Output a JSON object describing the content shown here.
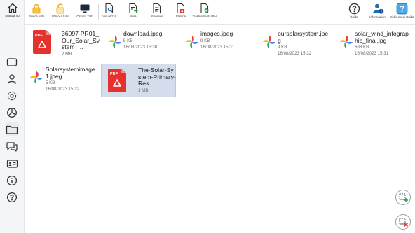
{
  "rail": {
    "home_label": "Stanza 4b",
    "items": [
      "square-icon",
      "person-outline-icon",
      "gear-icon",
      "pie-chart-icon",
      "folder-icon",
      "chat-bubbles-icon",
      "id-card-icon",
      "info-icon",
      "help-icon"
    ]
  },
  "toolbar": {
    "lock_all": "Blocca tutto",
    "unlock_all": "Sblocca tutto",
    "darken_all": "Oscura Tutti",
    "view": "Visualizza",
    "send": "Invia",
    "rename": "Rinomina",
    "delete": "Elimina",
    "transfers": "Trasferimenti attivi",
    "guide": "Guida",
    "info": "Informazioni",
    "guide_requests": "Richieste di Guida"
  },
  "files": [
    {
      "name": "36097-PR01_Our_Solar_System_...",
      "meta1": "2 MB",
      "meta2": "",
      "type": "pdf"
    },
    {
      "name": "download.jpeg",
      "meta1": "5 KB",
      "meta2": "16/08/2023 15:30",
      "type": "image"
    },
    {
      "name": "images.jpeg",
      "meta1": "9 KB",
      "meta2": "16/08/2023 15:31",
      "type": "image"
    },
    {
      "name": "oursolarsystem.jpeg",
      "meta1": "9 KB",
      "meta2": "16/08/2023 15:32",
      "type": "image"
    },
    {
      "name": "solar_wind_infographic_final.jpg",
      "meta1": "688 KB",
      "meta2": "16/08/2023 15:31",
      "type": "image"
    },
    {
      "name": "Solarsystemimage1.jpeg",
      "meta1": "5 KB",
      "meta2": "16/08/2023 15:32",
      "type": "image"
    },
    {
      "name": "The-Solar-System-Primary-Res...",
      "meta1": "1 MB",
      "meta2": "",
      "type": "pdf",
      "selected": true
    }
  ],
  "colors": {
    "accent": "#1f6fb2",
    "pdf": "#e5322d",
    "selected": "#d3ddec",
    "lock": "#f2a900"
  }
}
